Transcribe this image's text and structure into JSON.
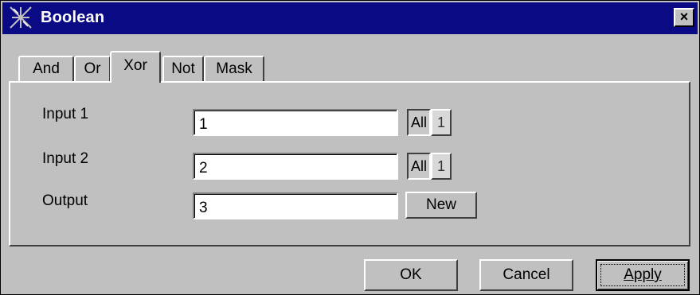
{
  "window": {
    "title": "Boolean",
    "close_label": "×"
  },
  "tabs": [
    {
      "label": "And"
    },
    {
      "label": "Or"
    },
    {
      "label": "Xor"
    },
    {
      "label": "Not"
    },
    {
      "label": "Mask"
    }
  ],
  "active_tab": "Xor",
  "form": {
    "input1": {
      "label": "Input 1",
      "value": "1",
      "all_label": "All",
      "one_label": "1"
    },
    "input2": {
      "label": "Input 2",
      "value": "2",
      "all_label": "All",
      "one_label": "1"
    },
    "output": {
      "label": "Output",
      "value": "3",
      "new_label": "New"
    }
  },
  "buttons": {
    "ok": "OK",
    "cancel": "Cancel",
    "apply": "Apply"
  }
}
